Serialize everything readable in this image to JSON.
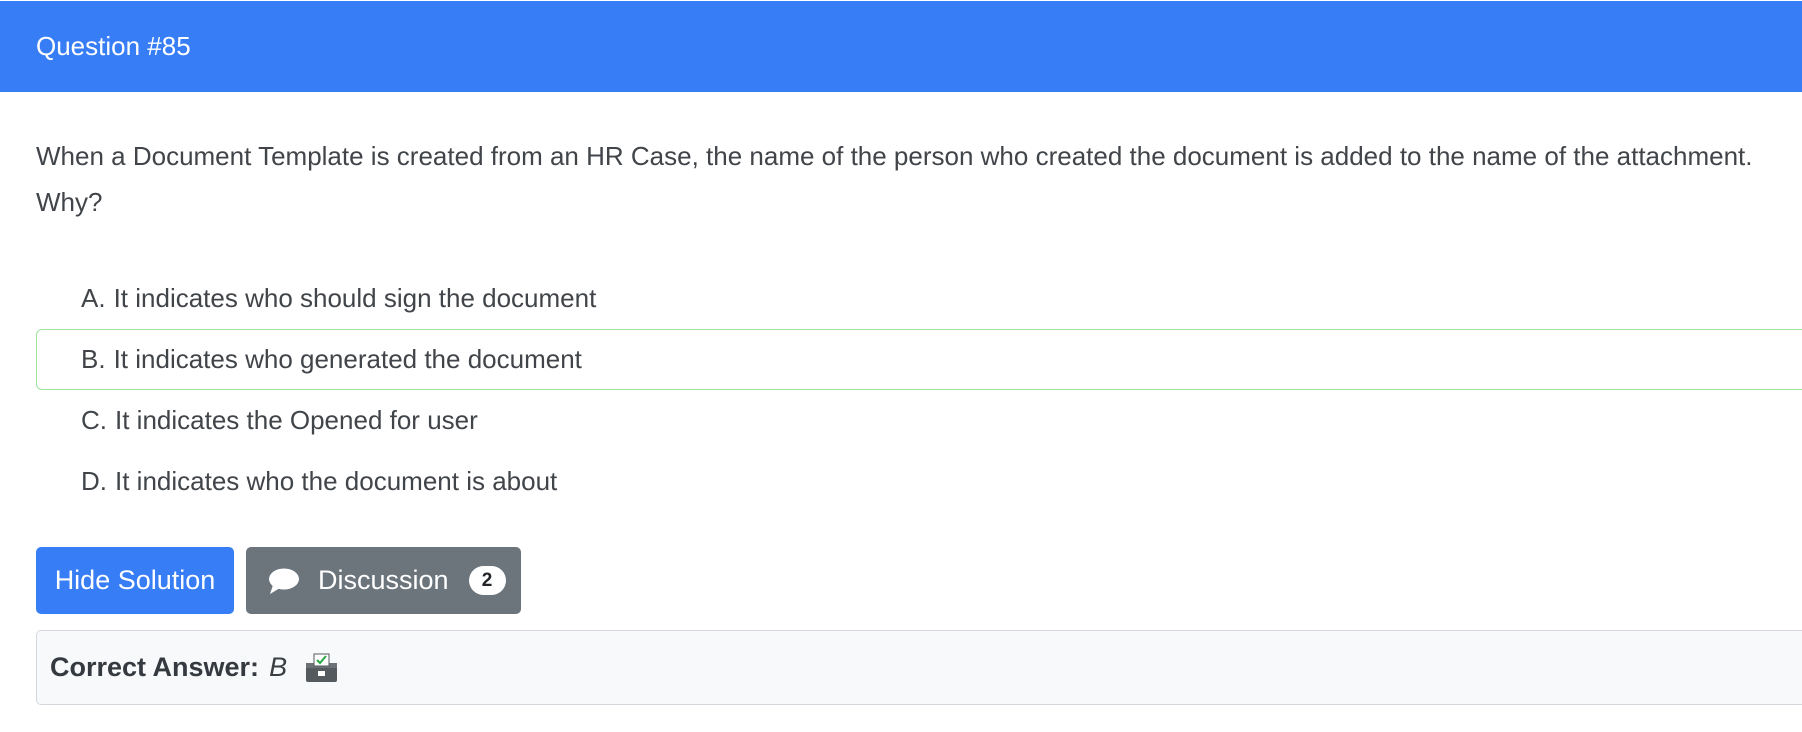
{
  "header": {
    "title": "Question #85"
  },
  "question": {
    "line1": "When a Document Template is created from an HR Case, the name of the person who created the document is added to the name of the attachment.",
    "line2": "Why?"
  },
  "choices": [
    {
      "letter": "A.",
      "text": "It indicates who should sign the document"
    },
    {
      "letter": "B.",
      "text": "It indicates who generated the document"
    },
    {
      "letter": "C.",
      "text": "It indicates the Opened for user"
    },
    {
      "letter": "D.",
      "text": "It indicates who the document is about"
    }
  ],
  "actions": {
    "hide_solution_label": "Hide Solution",
    "discussion_label": "Discussion",
    "discussion_count": "2"
  },
  "answer": {
    "label": "Correct Answer:",
    "value": "B"
  },
  "colors": {
    "primary": "#377df6",
    "secondary": "#6c747c",
    "correct_border": "#9fe39f"
  },
  "icons": {
    "discussion": "speech-bubble-icon",
    "vote": "ballot-box-icon"
  }
}
